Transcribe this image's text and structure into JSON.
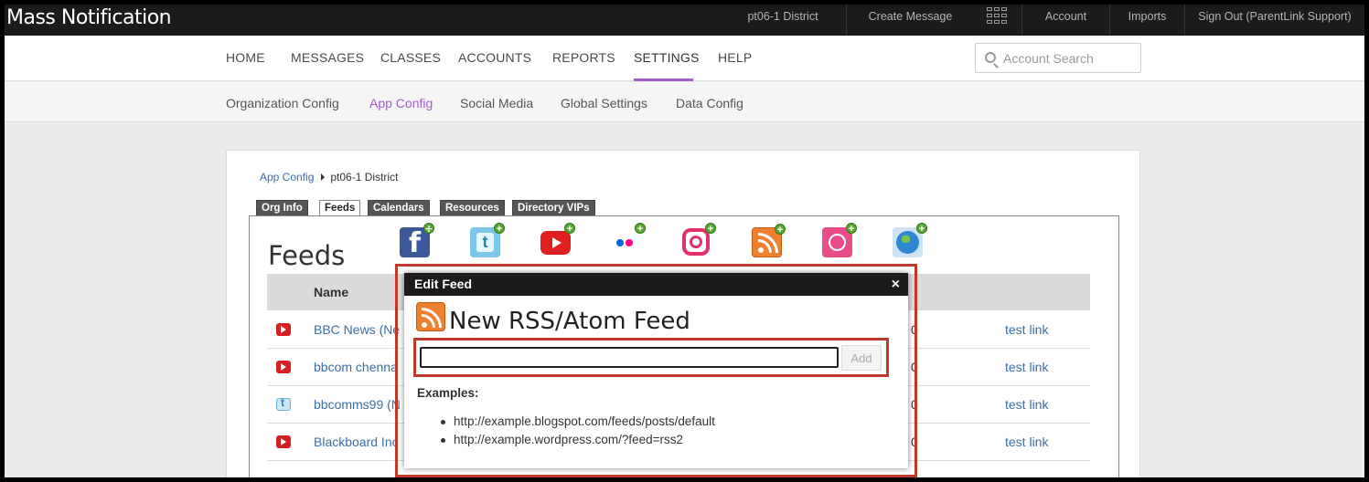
{
  "app": {
    "title": "Mass Notification"
  },
  "topbar": {
    "district": "pt06-1 District",
    "create_message": "Create Message",
    "apps_icon": "grid-icon",
    "account": "Account",
    "imports": "Imports",
    "sign_out": "Sign Out (ParentLink Support)"
  },
  "nav": {
    "items": [
      "HOME",
      "MESSAGES",
      "CLASSES",
      "ACCOUNTS",
      "REPORTS",
      "SETTINGS",
      "HELP"
    ],
    "active": "SETTINGS",
    "accent_color": "#a35dc7"
  },
  "search": {
    "placeholder": "Account Search",
    "value": ""
  },
  "subnav": {
    "items": [
      "Organization Config",
      "App Config",
      "Social Media",
      "Global Settings",
      "Data Config"
    ],
    "active": "App Config"
  },
  "breadcrumb": {
    "parent": "App Config",
    "current": "pt06-1 District"
  },
  "tabs": [
    "Org Info",
    "Feeds",
    "Calendars",
    "Resources",
    "Directory VIPs"
  ],
  "active_tab": "Feeds",
  "feeds": {
    "title": "Feeds",
    "add_icons": [
      "facebook-icon",
      "twitter-icon",
      "youtube-icon",
      "flickr-icon",
      "instagram-icon",
      "rss-icon",
      "dribbble-icon",
      "web-icon"
    ],
    "columns": {
      "name": "Name"
    },
    "rows": [
      {
        "icon": "youtube",
        "name": "BBC News (Ne",
        "frag": "0",
        "link": "test link"
      },
      {
        "icon": "youtube",
        "name": "bbcom chenna",
        "frag": "0",
        "link": "test link"
      },
      {
        "icon": "twitter",
        "name": "bbcomms99 (N",
        "frag": "0",
        "link": "test link"
      },
      {
        "icon": "youtube",
        "name": "Blackboard Inc",
        "frag": "0",
        "link": "test link"
      }
    ]
  },
  "modal": {
    "header": "Edit Feed",
    "close": "×",
    "title": "New RSS/Atom Feed",
    "input_value": "",
    "add_label": "Add",
    "examples_label": "Examples:",
    "examples": [
      "http://example.blogspot.com/feeds/posts/default",
      "http://example.wordpress.com/?feed=rss2"
    ],
    "highlight_color": "#c0392b"
  }
}
